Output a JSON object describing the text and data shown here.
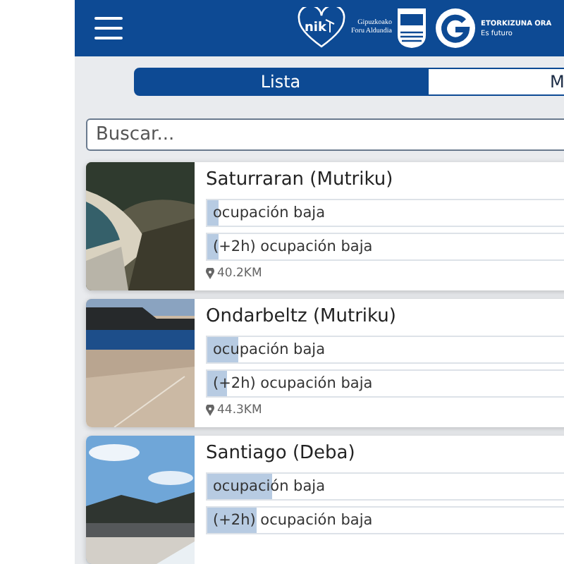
{
  "header": {
    "logo_nik": "nik",
    "logo_dept_lines": [
      "Gipuzkoako",
      "Foru Aldundia"
    ],
    "logo_future_title": "ETORKIZUNA ORA",
    "logo_future_sub": "Es futuro"
  },
  "tabs": [
    {
      "label": "Lista",
      "selected": true
    },
    {
      "label": "M",
      "selected": false
    }
  ],
  "search": {
    "placeholder": "Buscar..."
  },
  "beaches": [
    {
      "name": "Saturraran (Mutriku)",
      "now": {
        "text": "ocupación baja",
        "level": 0.03
      },
      "later": {
        "text": "(+2h) ocupación baja",
        "level": 0.03
      },
      "distance": "40.2KM"
    },
    {
      "name": "Ondarbeltz (Mutriku)",
      "now": {
        "text": "ocupación baja",
        "level": 0.08
      },
      "later": {
        "text": "(+2h) ocupación baja",
        "level": 0.05
      },
      "distance": "44.3KM"
    },
    {
      "name": "Santiago (Deba)",
      "now": {
        "text": "ocupación baja",
        "level": 0.17
      },
      "later": {
        "text": "(+2h) ocupación baja",
        "level": 0.13
      }
    }
  ]
}
